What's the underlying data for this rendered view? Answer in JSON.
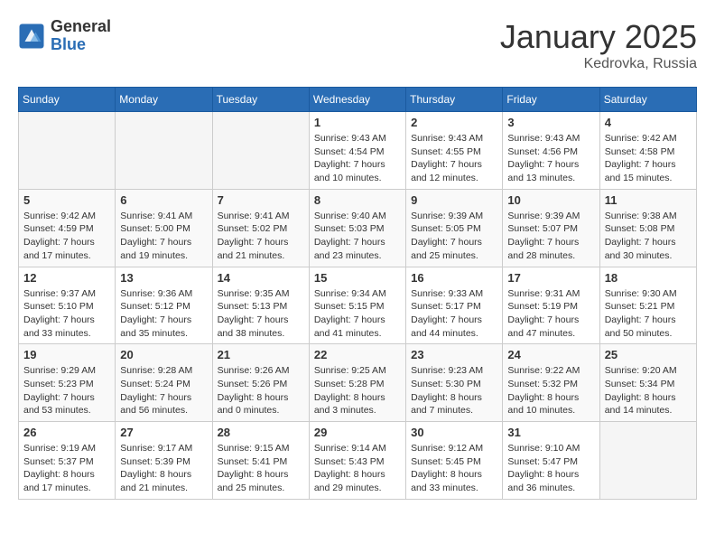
{
  "logo": {
    "general": "General",
    "blue": "Blue"
  },
  "header": {
    "month": "January 2025",
    "location": "Kedrovka, Russia"
  },
  "weekdays": [
    "Sunday",
    "Monday",
    "Tuesday",
    "Wednesday",
    "Thursday",
    "Friday",
    "Saturday"
  ],
  "weeks": [
    [
      {
        "day": "",
        "info": ""
      },
      {
        "day": "",
        "info": ""
      },
      {
        "day": "",
        "info": ""
      },
      {
        "day": "1",
        "info": "Sunrise: 9:43 AM\nSunset: 4:54 PM\nDaylight: 7 hours\nand 10 minutes."
      },
      {
        "day": "2",
        "info": "Sunrise: 9:43 AM\nSunset: 4:55 PM\nDaylight: 7 hours\nand 12 minutes."
      },
      {
        "day": "3",
        "info": "Sunrise: 9:43 AM\nSunset: 4:56 PM\nDaylight: 7 hours\nand 13 minutes."
      },
      {
        "day": "4",
        "info": "Sunrise: 9:42 AM\nSunset: 4:58 PM\nDaylight: 7 hours\nand 15 minutes."
      }
    ],
    [
      {
        "day": "5",
        "info": "Sunrise: 9:42 AM\nSunset: 4:59 PM\nDaylight: 7 hours\nand 17 minutes."
      },
      {
        "day": "6",
        "info": "Sunrise: 9:41 AM\nSunset: 5:00 PM\nDaylight: 7 hours\nand 19 minutes."
      },
      {
        "day": "7",
        "info": "Sunrise: 9:41 AM\nSunset: 5:02 PM\nDaylight: 7 hours\nand 21 minutes."
      },
      {
        "day": "8",
        "info": "Sunrise: 9:40 AM\nSunset: 5:03 PM\nDaylight: 7 hours\nand 23 minutes."
      },
      {
        "day": "9",
        "info": "Sunrise: 9:39 AM\nSunset: 5:05 PM\nDaylight: 7 hours\nand 25 minutes."
      },
      {
        "day": "10",
        "info": "Sunrise: 9:39 AM\nSunset: 5:07 PM\nDaylight: 7 hours\nand 28 minutes."
      },
      {
        "day": "11",
        "info": "Sunrise: 9:38 AM\nSunset: 5:08 PM\nDaylight: 7 hours\nand 30 minutes."
      }
    ],
    [
      {
        "day": "12",
        "info": "Sunrise: 9:37 AM\nSunset: 5:10 PM\nDaylight: 7 hours\nand 33 minutes."
      },
      {
        "day": "13",
        "info": "Sunrise: 9:36 AM\nSunset: 5:12 PM\nDaylight: 7 hours\nand 35 minutes."
      },
      {
        "day": "14",
        "info": "Sunrise: 9:35 AM\nSunset: 5:13 PM\nDaylight: 7 hours\nand 38 minutes."
      },
      {
        "day": "15",
        "info": "Sunrise: 9:34 AM\nSunset: 5:15 PM\nDaylight: 7 hours\nand 41 minutes."
      },
      {
        "day": "16",
        "info": "Sunrise: 9:33 AM\nSunset: 5:17 PM\nDaylight: 7 hours\nand 44 minutes."
      },
      {
        "day": "17",
        "info": "Sunrise: 9:31 AM\nSunset: 5:19 PM\nDaylight: 7 hours\nand 47 minutes."
      },
      {
        "day": "18",
        "info": "Sunrise: 9:30 AM\nSunset: 5:21 PM\nDaylight: 7 hours\nand 50 minutes."
      }
    ],
    [
      {
        "day": "19",
        "info": "Sunrise: 9:29 AM\nSunset: 5:23 PM\nDaylight: 7 hours\nand 53 minutes."
      },
      {
        "day": "20",
        "info": "Sunrise: 9:28 AM\nSunset: 5:24 PM\nDaylight: 7 hours\nand 56 minutes."
      },
      {
        "day": "21",
        "info": "Sunrise: 9:26 AM\nSunset: 5:26 PM\nDaylight: 8 hours\nand 0 minutes."
      },
      {
        "day": "22",
        "info": "Sunrise: 9:25 AM\nSunset: 5:28 PM\nDaylight: 8 hours\nand 3 minutes."
      },
      {
        "day": "23",
        "info": "Sunrise: 9:23 AM\nSunset: 5:30 PM\nDaylight: 8 hours\nand 7 minutes."
      },
      {
        "day": "24",
        "info": "Sunrise: 9:22 AM\nSunset: 5:32 PM\nDaylight: 8 hours\nand 10 minutes."
      },
      {
        "day": "25",
        "info": "Sunrise: 9:20 AM\nSunset: 5:34 PM\nDaylight: 8 hours\nand 14 minutes."
      }
    ],
    [
      {
        "day": "26",
        "info": "Sunrise: 9:19 AM\nSunset: 5:37 PM\nDaylight: 8 hours\nand 17 minutes."
      },
      {
        "day": "27",
        "info": "Sunrise: 9:17 AM\nSunset: 5:39 PM\nDaylight: 8 hours\nand 21 minutes."
      },
      {
        "day": "28",
        "info": "Sunrise: 9:15 AM\nSunset: 5:41 PM\nDaylight: 8 hours\nand 25 minutes."
      },
      {
        "day": "29",
        "info": "Sunrise: 9:14 AM\nSunset: 5:43 PM\nDaylight: 8 hours\nand 29 minutes."
      },
      {
        "day": "30",
        "info": "Sunrise: 9:12 AM\nSunset: 5:45 PM\nDaylight: 8 hours\nand 33 minutes."
      },
      {
        "day": "31",
        "info": "Sunrise: 9:10 AM\nSunset: 5:47 PM\nDaylight: 8 hours\nand 36 minutes."
      },
      {
        "day": "",
        "info": ""
      }
    ]
  ]
}
